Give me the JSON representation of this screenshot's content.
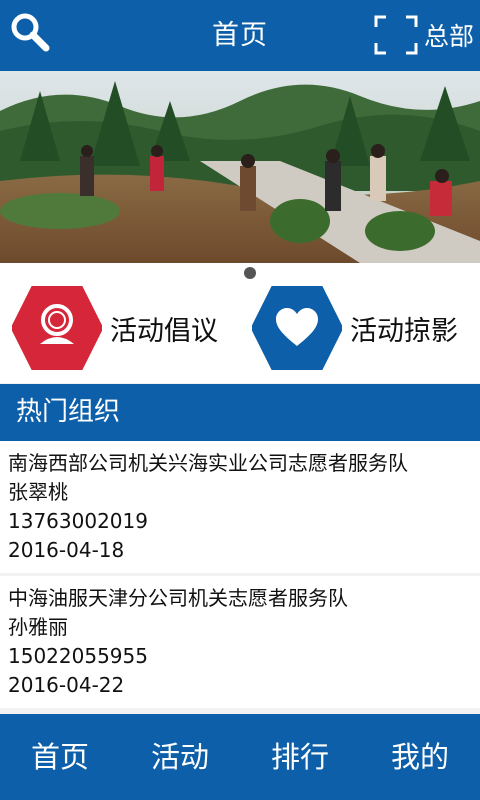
{
  "header": {
    "title": "首页",
    "hq_label": "总部",
    "search_icon": "search-icon",
    "scan_icon": "scan-icon"
  },
  "banner": {
    "pager": {
      "count": 1,
      "active": 1
    }
  },
  "quick_actions": [
    {
      "label": "活动倡议",
      "icon": "advocate-icon",
      "color": "#d6263a"
    },
    {
      "label": "活动掠影",
      "icon": "heart-icon",
      "color": "#0c5fa8"
    }
  ],
  "section": {
    "title": "热门组织"
  },
  "orgs": [
    {
      "name": "南海西部公司机关兴海实业公司志愿者服务队",
      "contact": "张翠桃",
      "phone": "13763002019",
      "date": "2016-04-18"
    },
    {
      "name": "中海油服天津分公司机关志愿者服务队",
      "contact": "孙雅丽",
      "phone": "15022055955",
      "date": "2016-04-22"
    }
  ],
  "bottom_nav": [
    {
      "label": "首页"
    },
    {
      "label": "活动"
    },
    {
      "label": "排行"
    },
    {
      "label": "我的"
    }
  ],
  "colors": {
    "primary": "#0c5fa8",
    "accent_red": "#d6263a"
  }
}
